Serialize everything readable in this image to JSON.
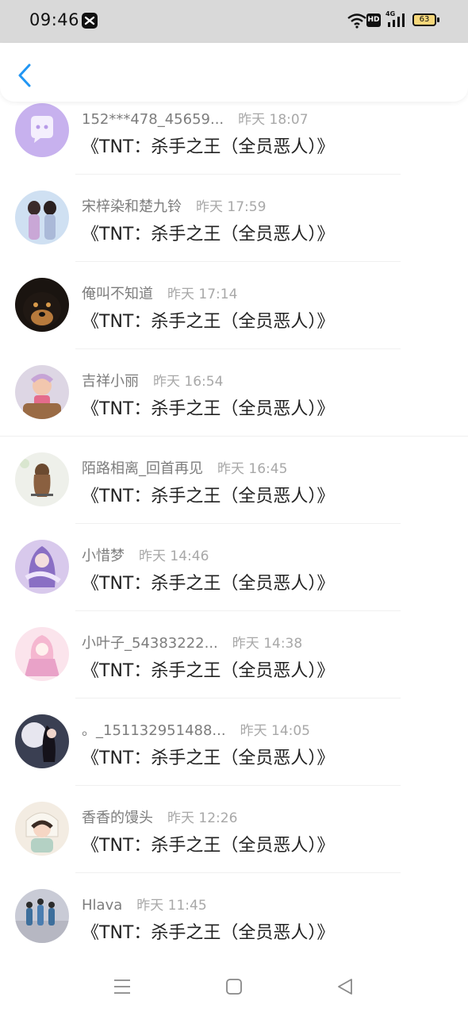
{
  "status_bar": {
    "time": "09:46",
    "network_label": "4G",
    "hd_label": "HD",
    "battery_level": "63"
  },
  "header": {
    "back_icon": "chevron-left-icon",
    "accent_color": "#2196F3"
  },
  "items": [
    {
      "name": "152***478_45659...",
      "time": "昨天 18:07",
      "message": "《TNT：杀手之王（全员恶人）》"
    },
    {
      "name": "宋梓染和楚九铃",
      "time": "昨天 17:59",
      "message": "《TNT：杀手之王（全员恶人）》"
    },
    {
      "name": "俺叫不知道",
      "time": "昨天 17:14",
      "message": "《TNT：杀手之王（全员恶人）》"
    },
    {
      "name": "吉祥小丽",
      "time": "昨天 16:54",
      "message": "《TNT：杀手之王（全员恶人）》"
    },
    {
      "name": "陌路相离_回首再见",
      "time": "昨天 16:45",
      "message": "《TNT：杀手之王（全员恶人）》"
    },
    {
      "name": "小惜梦",
      "time": "昨天 14:46",
      "message": "《TNT：杀手之王（全员恶人）》"
    },
    {
      "name": "小叶子_54383222...",
      "time": "昨天 14:38",
      "message": "《TNT：杀手之王（全员恶人）》"
    },
    {
      "name": "。_151132951488...",
      "time": "昨天 14:05",
      "message": "《TNT：杀手之王（全员恶人）》"
    },
    {
      "name": "香香的馒头",
      "time": "昨天 12:26",
      "message": "《TNT：杀手之王（全员恶人）》"
    },
    {
      "name": "Hlava",
      "time": "昨天 11:45",
      "message": "《TNT：杀手之王（全员恶人）》"
    }
  ],
  "nav_bar": {
    "menu_icon": "menu-icon",
    "home_icon": "home-square-icon",
    "back_icon": "back-triangle-icon"
  }
}
